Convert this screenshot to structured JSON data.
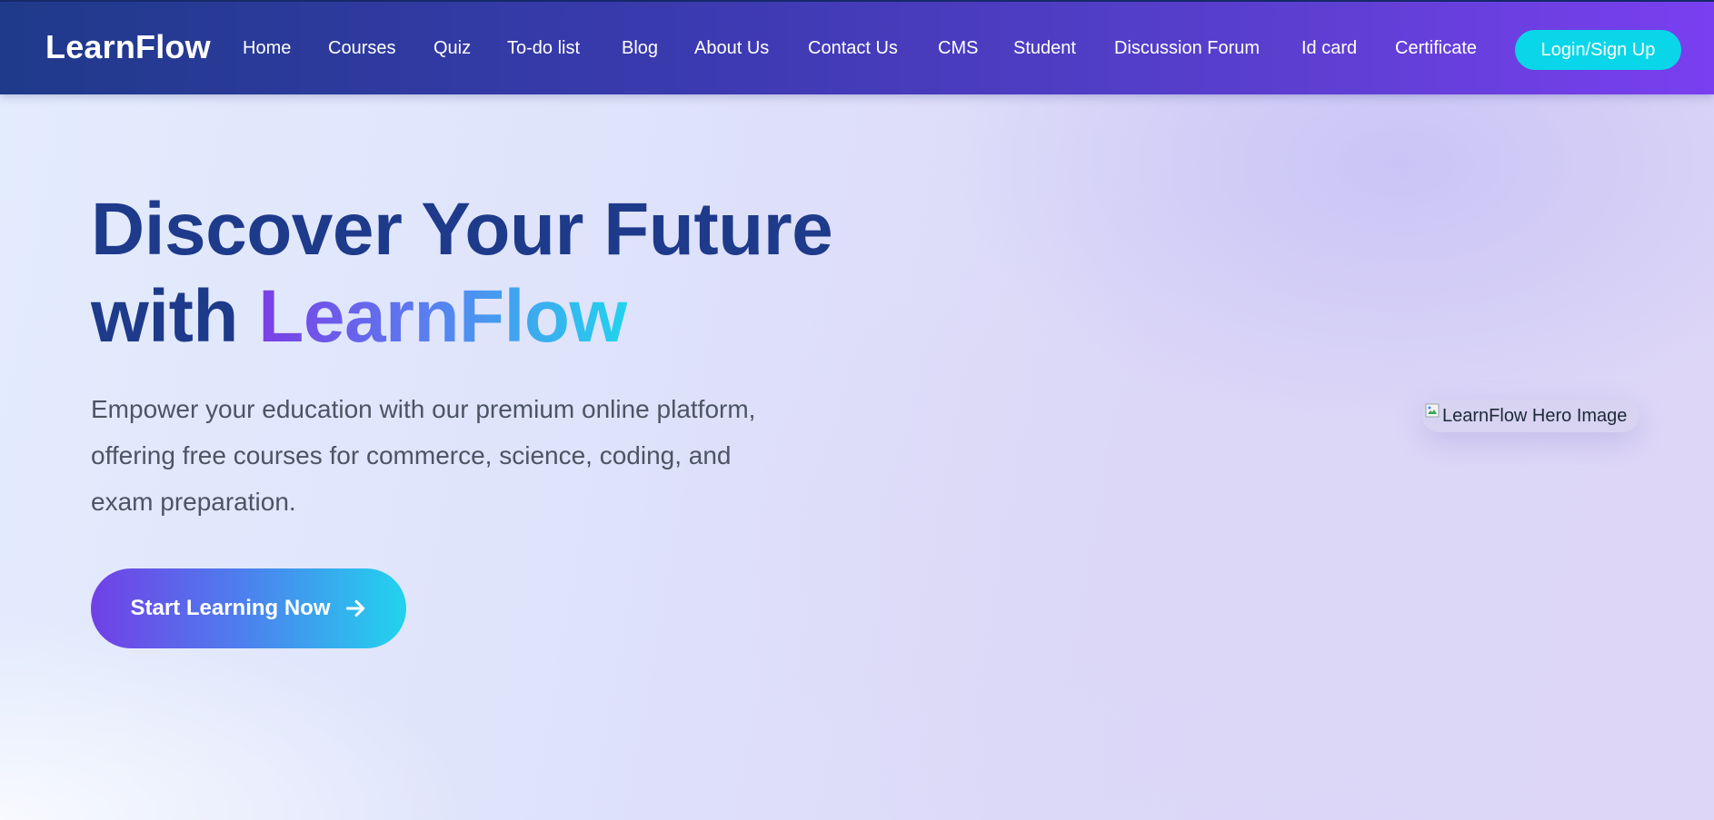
{
  "nav": {
    "brand": "LearnFlow",
    "links": [
      "Home",
      "Courses",
      "Quiz",
      "To-do list",
      "Blog",
      "About Us",
      "Contact Us",
      "CMS",
      "Student",
      "Discussion Forum",
      "Id card",
      "Certificate"
    ],
    "login_label": "Login/Sign Up"
  },
  "hero": {
    "title_line1": "Discover Your Future",
    "title_with": "with ",
    "title_brand": "LearnFlow",
    "description": "Empower your education with our premium online platform, offering free courses for commerce, science, coding, and exam preparation.",
    "cta_label": "Start Learning Now",
    "cta_icon": "arrow-right-icon",
    "image_alt": "LearnFlow Hero Image",
    "image_icon": "broken-image-icon"
  },
  "colors": {
    "nav_start": "#1f3a8a",
    "nav_end": "#7a3ff0",
    "login_button": "#0ad6e9",
    "title": "#1e3a8a",
    "description": "#4b5563"
  }
}
